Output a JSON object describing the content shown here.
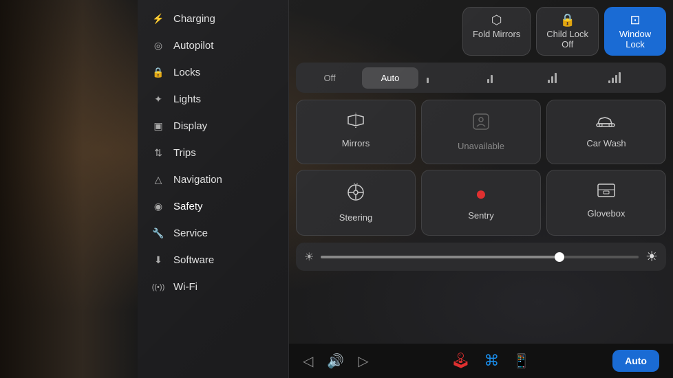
{
  "sidebar": {
    "items": [
      {
        "id": "charging",
        "label": "Charging",
        "icon": "⚡"
      },
      {
        "id": "autopilot",
        "label": "Autopilot",
        "icon": "◎"
      },
      {
        "id": "locks",
        "label": "Locks",
        "icon": "🔒"
      },
      {
        "id": "lights",
        "label": "Lights",
        "icon": "✦"
      },
      {
        "id": "display",
        "label": "Display",
        "icon": "▣"
      },
      {
        "id": "trips",
        "label": "Trips",
        "icon": "⇅"
      },
      {
        "id": "navigation",
        "label": "Navigation",
        "icon": "△"
      },
      {
        "id": "safety",
        "label": "Safety",
        "icon": "◉"
      },
      {
        "id": "service",
        "label": "Service",
        "icon": "🔧"
      },
      {
        "id": "software",
        "label": "Software",
        "icon": "⬇"
      },
      {
        "id": "wifi",
        "label": "Wi-Fi",
        "icon": "((•))"
      }
    ]
  },
  "topButtons": [
    {
      "id": "fold-mirrors",
      "label": "Fold Mirrors",
      "icon": "⬡",
      "active": false
    },
    {
      "id": "child-lock",
      "label": "Child Lock\nOff",
      "icon": "🔒",
      "active": false
    },
    {
      "id": "window-lock",
      "label": "Window\nLock",
      "icon": "⊡",
      "active": true
    }
  ],
  "fanOptions": [
    {
      "id": "off",
      "label": "Off",
      "selected": false
    },
    {
      "id": "auto",
      "label": "Auto",
      "selected": true
    },
    {
      "id": "speed1",
      "label": "|",
      "selected": false
    },
    {
      "id": "speed2",
      "label": "||",
      "selected": false
    },
    {
      "id": "speed3",
      "label": "|||",
      "selected": false
    },
    {
      "id": "speed4",
      "label": "||||",
      "selected": false
    }
  ],
  "gridButtons": [
    {
      "id": "mirrors",
      "label": "Mirrors",
      "icon": "⬡↕",
      "style": "normal"
    },
    {
      "id": "unavailable",
      "label": "Unavailable",
      "icon": "⊟",
      "style": "unavailable"
    },
    {
      "id": "car-wash",
      "label": "Car Wash",
      "icon": "🚗",
      "style": "normal"
    },
    {
      "id": "steering",
      "label": "Steering",
      "icon": "⊙↕",
      "style": "normal"
    },
    {
      "id": "sentry",
      "label": "Sentry",
      "icon": "●",
      "style": "sentry"
    },
    {
      "id": "glovebox",
      "label": "Glovebox",
      "icon": "⊟",
      "style": "normal"
    }
  ],
  "brightness": {
    "icon": "☀",
    "level": 75
  },
  "bottomBar": {
    "leftIcons": [
      "◁",
      "🔊",
      "▷"
    ],
    "centerIcons": [
      {
        "id": "joystick",
        "color": "red",
        "icon": "🕹"
      },
      {
        "id": "bluetooth",
        "color": "blue",
        "icon": "⌘"
      }
    ],
    "autoButton": "Auto"
  }
}
